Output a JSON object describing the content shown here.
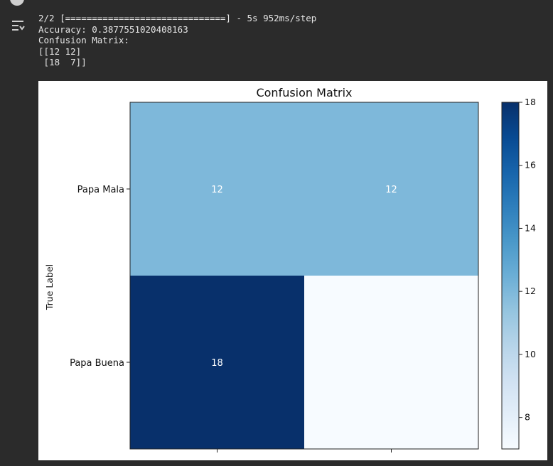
{
  "console": {
    "progress_line": "2/2 [==============================] - 5s 952ms/step",
    "accuracy_line": "Accuracy: 0.3877551020408163",
    "matrix_label": "Confusion Matrix:",
    "matrix_row1": "[[12 12]",
    "matrix_row2": " [18  7]]"
  },
  "chart_data": {
    "type": "heatmap",
    "title": "Confusion Matrix",
    "ylabel": "True Label",
    "xlabel": "",
    "row_labels": [
      "Papa Mala",
      "Papa Buena"
    ],
    "col_labels": [
      "",
      ""
    ],
    "values": [
      [
        12,
        12
      ],
      [
        18,
        7
      ]
    ],
    "cell_annotations": [
      [
        "12",
        "12"
      ],
      [
        "18",
        ""
      ]
    ],
    "colormap": "Blues",
    "colorbar": {
      "min": 7,
      "max": 18,
      "ticks": [
        8,
        10,
        12,
        14,
        16,
        18
      ]
    }
  },
  "colors": {
    "cell_12": "#7fb5d9",
    "cell_18": "#08306b",
    "cell_7": "#f7fbff",
    "annotation_text": "#ffffff"
  }
}
